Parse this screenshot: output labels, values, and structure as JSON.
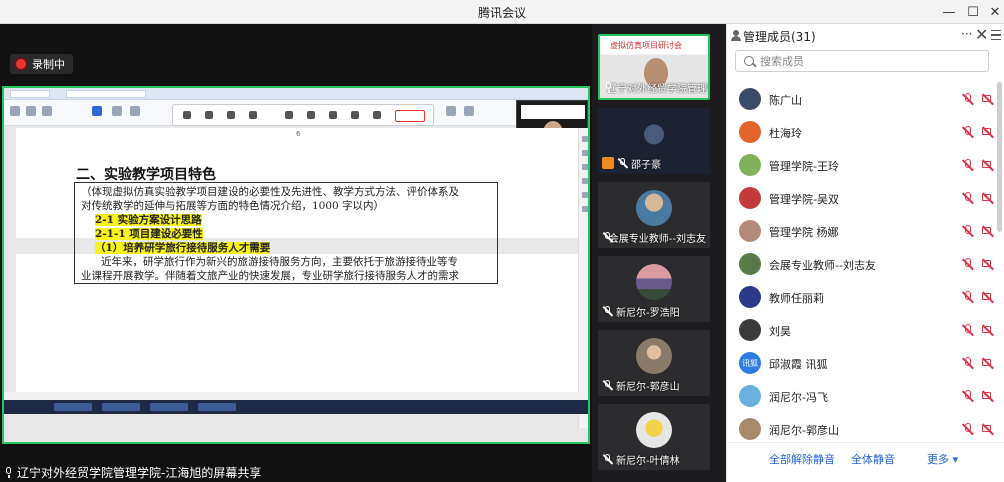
{
  "window": {
    "title": "腾讯会议",
    "minimize": "—",
    "maximize": "☐",
    "close": "✕"
  },
  "stage": {
    "recording_label": "录制中",
    "share_label": "辽宁对外经贸学院管理学院-江海旭的屏幕共享",
    "document": {
      "page_number": "6",
      "heading": "二、实验教学项目特色",
      "box_lines": [
        "（体现虚拟仿真实验教学项目建设的必要性及先进性、教学方式方法、评价体系及",
        "对传统教学的延伸与拓展等方面的特色情况介绍，1000 字以内）"
      ],
      "hl1": "2-1 实验方案设计思路",
      "hl2": "2-1-1 项目建设必要性",
      "hl3": "（1）培养研学旅行接待服务人才需要",
      "para1": "近年来，研学旅行作为新兴的旅游接待服务方向，主要依托于旅游接待业等专",
      "para2": "业课程开展教学。伴随着文旅产业的快速发展，专业研学旅行接待服务人才的需求"
    }
  },
  "videos": [
    {
      "name": "辽宁对外经贸学院管理学...",
      "mic": "on",
      "slide_title": "虚拟仿真项目研讨会"
    },
    {
      "name": "邵子豪",
      "mic": "off"
    },
    {
      "name": "会展专业教师--刘志友",
      "mic": "off"
    },
    {
      "name": "新尼尔-罗浩阳",
      "mic": "off"
    },
    {
      "name": "新尼尔-郭彦山",
      "mic": "off"
    },
    {
      "name": "新尼尔-叶倩林",
      "mic": "off"
    }
  ],
  "panel": {
    "title": "管理成员(31)",
    "more": "···",
    "close": "✕",
    "search_placeholder": "搜索成员",
    "members": [
      {
        "name": "陈广山",
        "avatar_color": "#3a4a6a",
        "avatar_text": ""
      },
      {
        "name": "杜海玲",
        "avatar_color": "#e2642a",
        "avatar_text": ""
      },
      {
        "name": "管理学院-王玲",
        "avatar_color": "#7fb35a",
        "avatar_text": ""
      },
      {
        "name": "管理学院-吴双",
        "avatar_color": "#c23a3a",
        "avatar_text": ""
      },
      {
        "name": "管理学院 杨娜",
        "avatar_color": "#b48a78",
        "avatar_text": ""
      },
      {
        "name": "会展专业教师--刘志友",
        "avatar_color": "#5a7a4a",
        "avatar_text": ""
      },
      {
        "name": "教师任丽莉",
        "avatar_color": "#2a3a8a",
        "avatar_text": ""
      },
      {
        "name": "刘昊",
        "avatar_color": "#3a3a3a",
        "avatar_text": ""
      },
      {
        "name": "邱淑霞 讯狐",
        "avatar_color": "#2d7ce6",
        "avatar_text": "讯狐"
      },
      {
        "name": "润尼尔-冯飞",
        "avatar_color": "#6ab0e0",
        "avatar_text": ""
      },
      {
        "name": "润尼尔-郭彦山",
        "avatar_color": "#a88a6a",
        "avatar_text": ""
      }
    ],
    "footer": {
      "unmute_all": "全部解除静音",
      "mute_all": "全体静音",
      "more": "更多 ▾"
    }
  },
  "colors": {
    "accent": "#22c55e",
    "link": "#2566d6",
    "muted_icon": "#e0344a",
    "highlight": "#f7f31a"
  }
}
